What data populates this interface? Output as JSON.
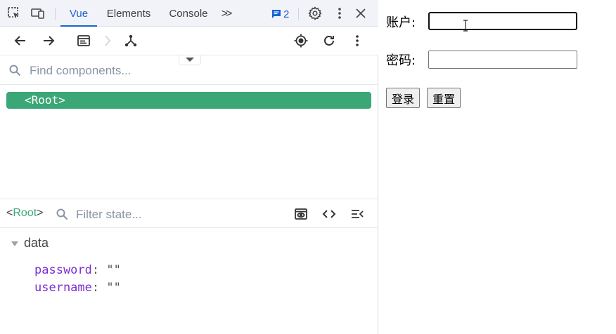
{
  "devtools": {
    "tabs": [
      {
        "label": "Vue",
        "active": true
      },
      {
        "label": "Elements",
        "active": false
      },
      {
        "label": "Console",
        "active": false
      }
    ],
    "overflow_label": ">>",
    "issues_count": "2",
    "icons": [
      "inspect-element-icon",
      "device-toolbar-icon",
      "issues-icon",
      "settings-icon",
      "kebab-menu-icon",
      "close-icon"
    ],
    "vue_toolbar_icons": [
      "back-arrow-icon",
      "forward-arrow-icon",
      "component-inspector-icon",
      "chevron-right-icon",
      "component-tree-icon",
      "select-component-icon",
      "refresh-icon",
      "kebab-menu-icon"
    ],
    "component_search": {
      "placeholder": "Find components..."
    },
    "tree": {
      "root_label": "<Root>"
    },
    "state": {
      "crumb_open": "<",
      "crumb_name": "Root",
      "crumb_close": ">",
      "filter_placeholder": "Filter state...",
      "section_label": "data",
      "props": [
        {
          "key": "password",
          "colon": ":",
          "value": "\"\""
        },
        {
          "key": "username",
          "colon": ":",
          "value": "\"\""
        }
      ]
    },
    "colors": {
      "accent": "#1a62d1",
      "vue_green": "#3ba776",
      "prop_key": "#7b2fd0"
    }
  },
  "page": {
    "account_label": "账户:",
    "password_label": "密码:",
    "account_value": "",
    "password_value": "",
    "login_button": "登录",
    "reset_button": "重置"
  }
}
